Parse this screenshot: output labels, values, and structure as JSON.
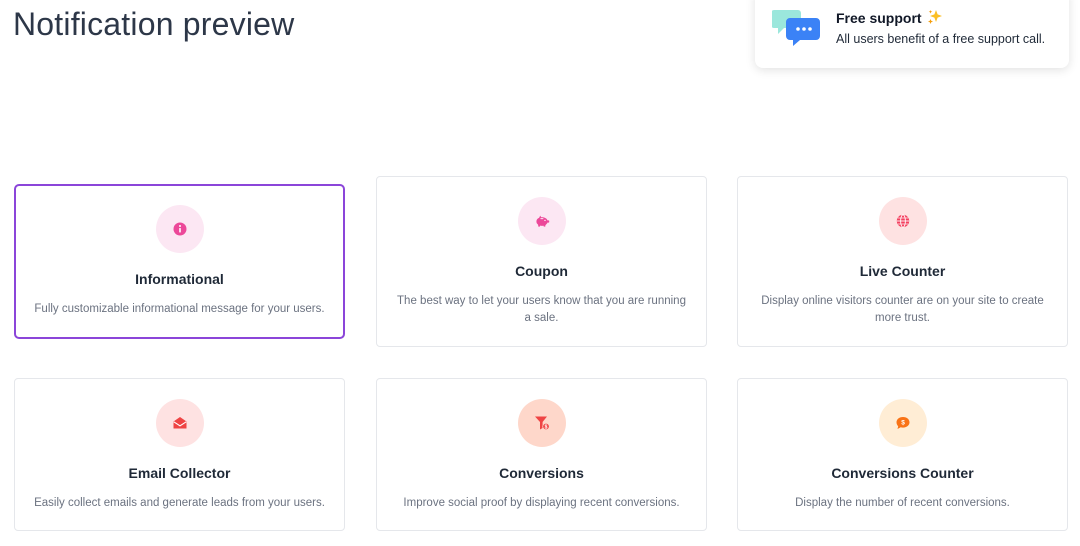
{
  "page": {
    "title": "Notification preview"
  },
  "support": {
    "title": "Free support",
    "text": "All users benefit of a free support call.",
    "icon": "chat-bubbles-icon",
    "sparkle_icon": "sparkles-icon"
  },
  "colors": {
    "selected_border": "#8b45d9",
    "card_border": "#e5e7eb"
  },
  "cards": [
    {
      "title": "Informational",
      "description": "Fully customizable informational message for your users.",
      "icon": "info-icon",
      "icon_bg": "#fce7f3",
      "icon_color": "#ec4899",
      "selected": true
    },
    {
      "title": "Coupon",
      "description": "The best way to let your users know that you are running a sale.",
      "icon": "piggy-bank-icon",
      "icon_bg": "#fce7f3",
      "icon_color": "#ec4899",
      "selected": false
    },
    {
      "title": "Live Counter",
      "description": "Display online visitors counter are on your site to create more trust.",
      "icon": "globe-icon",
      "icon_bg": "#fee2e2",
      "icon_color": "#f43f5e",
      "selected": false
    },
    {
      "title": "Email Collector",
      "description": "Easily collect emails and generate leads from your users.",
      "icon": "envelope-open-icon",
      "icon_bg": "#fee2e2",
      "icon_color": "#ef4444",
      "selected": false
    },
    {
      "title": "Conversions",
      "description": "Improve social proof by displaying recent conversions.",
      "icon": "funnel-dollar-icon",
      "icon_bg": "#fed7ca",
      "icon_color": "#ef4444",
      "selected": false
    },
    {
      "title": "Conversions Counter",
      "description": "Display the number of recent conversions.",
      "icon": "comment-dollar-icon",
      "icon_bg": "#ffedd5",
      "icon_color": "#f97316",
      "selected": false
    }
  ]
}
